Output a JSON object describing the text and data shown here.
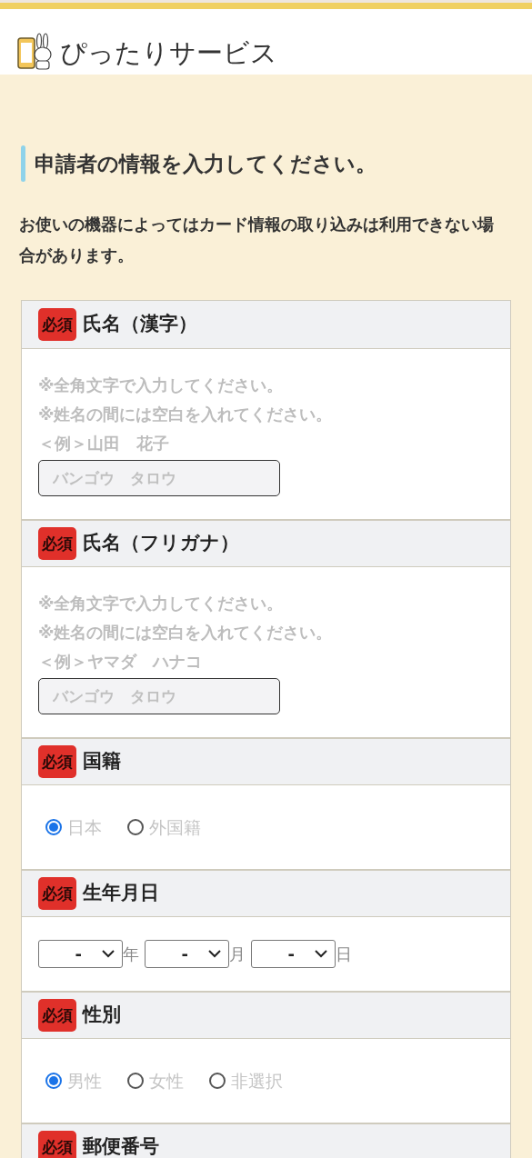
{
  "header": {
    "title": "ぴったりサービス"
  },
  "heading": "申請者の情報を入力してください。",
  "notice": "お使いの機器によってはカード情報の取り込みは利用できない場合があります。",
  "sections": [
    {
      "kind": "text",
      "badge": "必須",
      "label": "氏名（漢字）",
      "hints": [
        "※全角文字で入力してください。",
        "※姓名の間には空白を入れてください。",
        "＜例＞山田　花子"
      ],
      "placeholder": "バンゴウ　タロウ"
    },
    {
      "kind": "text",
      "badge": "必須",
      "label": "氏名（フリガナ）",
      "hints": [
        "※全角文字で入力してください。",
        "※姓名の間には空白を入れてください。",
        "＜例＞ヤマダ　ハナコ"
      ],
      "placeholder": "バンゴウ　タロウ"
    },
    {
      "kind": "radio",
      "badge": "必須",
      "label": "国籍",
      "options": [
        {
          "label": "日本",
          "selected": true
        },
        {
          "label": "外国籍",
          "selected": false
        }
      ]
    },
    {
      "kind": "date",
      "badge": "必須",
      "label": "生年月日",
      "selects": [
        {
          "value": "-",
          "unit": "年"
        },
        {
          "value": "-",
          "unit": "月"
        },
        {
          "value": "-",
          "unit": "日"
        }
      ]
    },
    {
      "kind": "radio",
      "badge": "必須",
      "label": "性別",
      "options": [
        {
          "label": "男性",
          "selected": true
        },
        {
          "label": "女性",
          "selected": false
        },
        {
          "label": "非選択",
          "selected": false
        }
      ]
    },
    {
      "kind": "header_only",
      "badge": "必須",
      "label": "郵便番号"
    }
  ]
}
